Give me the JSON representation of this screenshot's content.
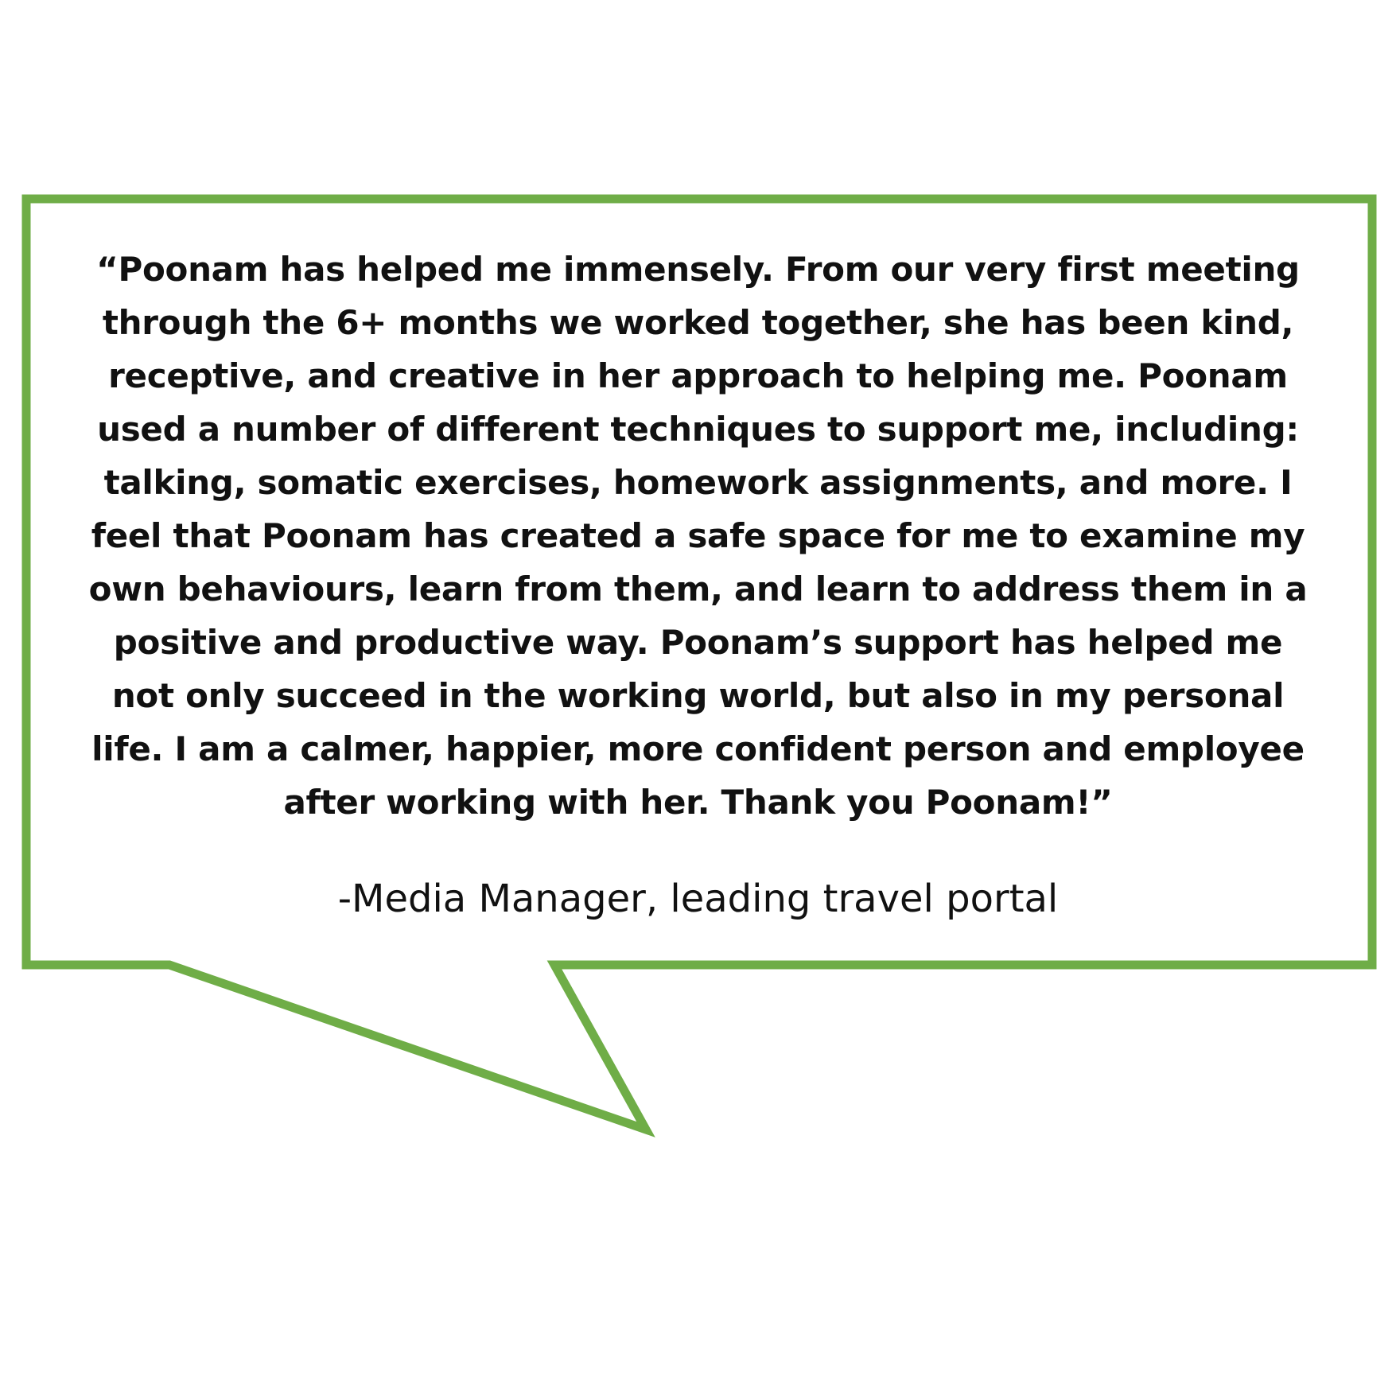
{
  "colors": {
    "bubble_border": "#6fad47",
    "background": "#ffffff",
    "text": "#111111"
  },
  "testimonial": {
    "quote_lines": [
      "“Poonam has helped me immensely. From our very first meeting",
      "through the 6+ months we worked together, she has been kind,",
      "receptive, and creative in her approach to helping me. Poonam",
      "used a number of different techniques to support me, including:",
      "talking, somatic exercises, homework assignments, and more. I",
      "feel that Poonam has created a safe space for me to examine my",
      "own behaviours, learn from them, and learn to address them in a",
      "positive and productive way. Poonam’s support has helped me",
      "not only succeed in the working world, but also in my personal",
      "life. I am a calmer, happier, more confident person and employee",
      "after working with her. Thank you Poonam!”"
    ],
    "attribution": "-Media Manager, leading travel portal"
  }
}
